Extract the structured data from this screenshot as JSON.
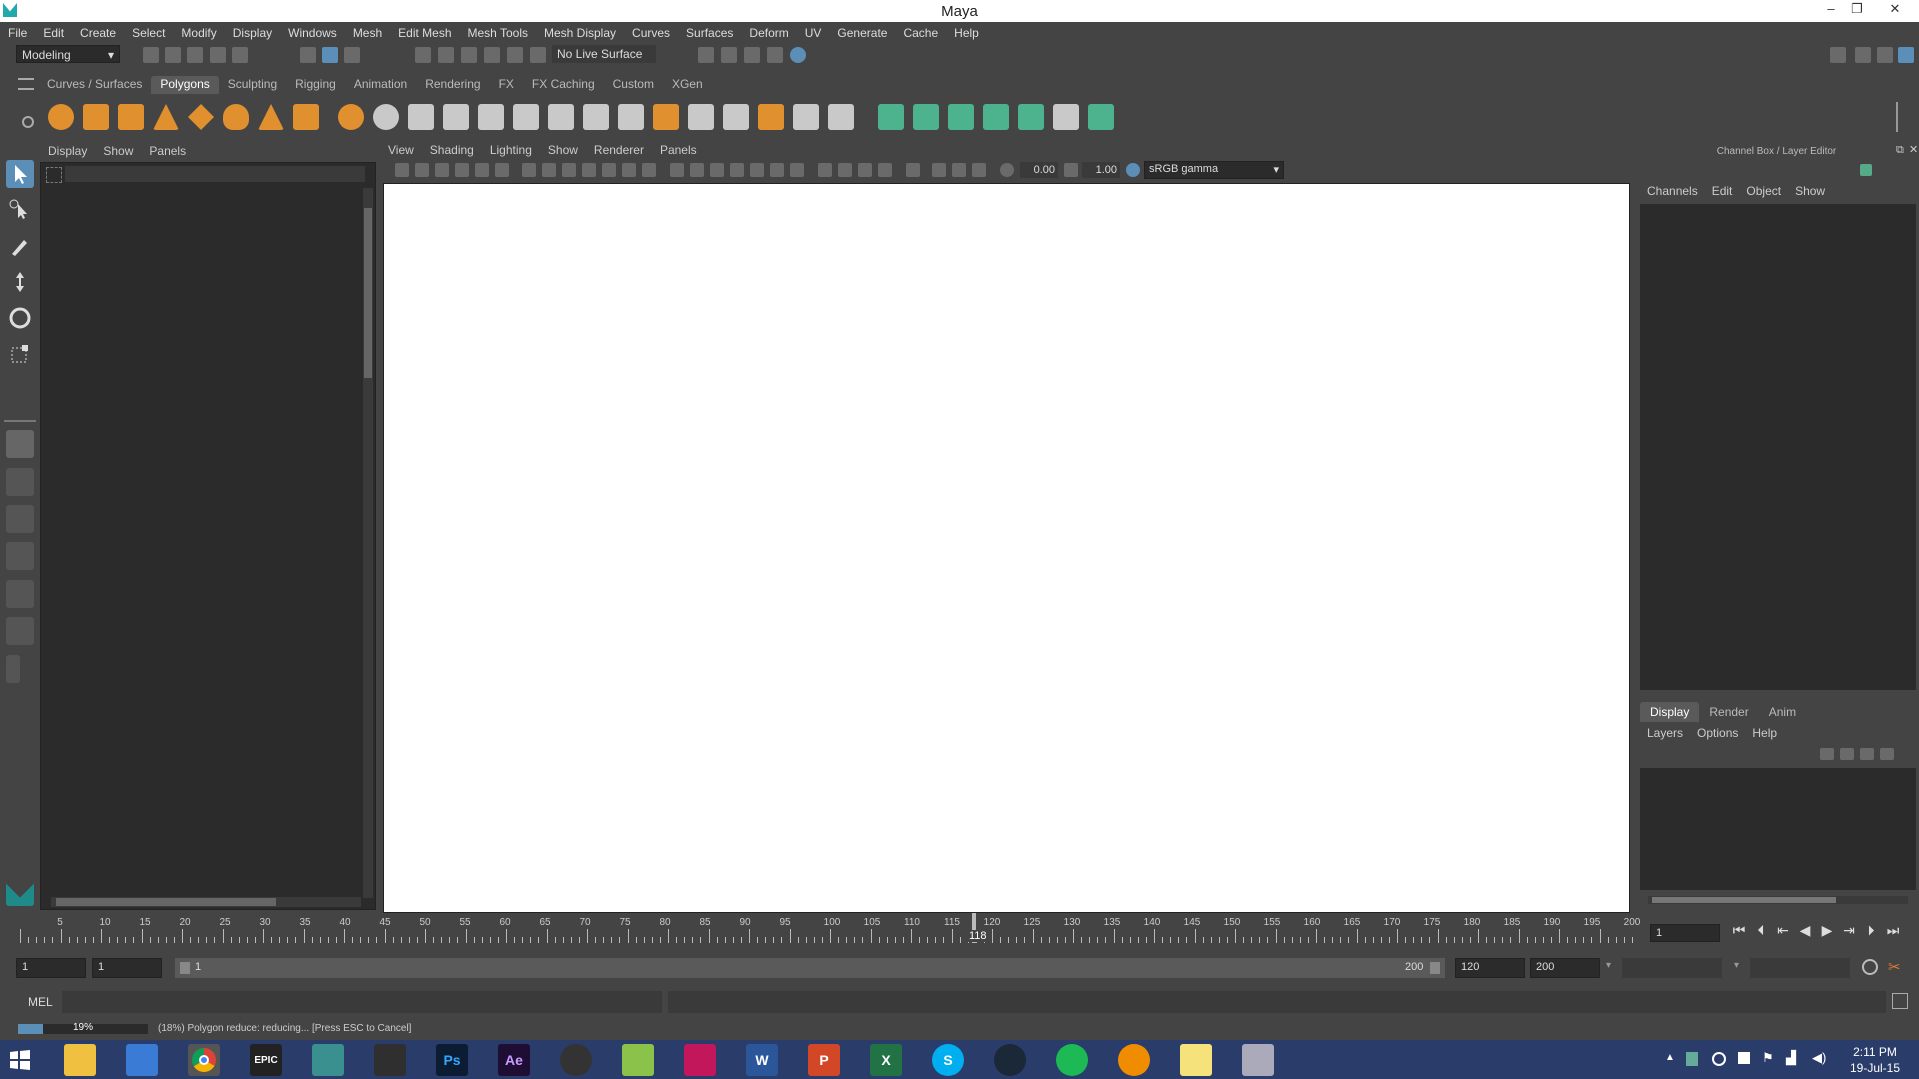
{
  "window": {
    "title": "Maya",
    "minimize": "–",
    "restore": "❐",
    "close": "✕"
  },
  "menubar": [
    "File",
    "Edit",
    "Create",
    "Select",
    "Modify",
    "Display",
    "Windows",
    "Mesh",
    "Edit Mesh",
    "Mesh Tools",
    "Mesh Display",
    "Curves",
    "Surfaces",
    "Deform",
    "UV",
    "Generate",
    "Cache",
    "Help"
  ],
  "statusline": {
    "mode": "Modeling",
    "live_surface": "No Live Surface"
  },
  "shelf": {
    "tabs": [
      "Curves / Surfaces",
      "Polygons",
      "Sculpting",
      "Rigging",
      "Animation",
      "Rendering",
      "FX",
      "FX Caching",
      "Custom",
      "XGen"
    ],
    "active": "Polygons"
  },
  "outliner": {
    "menu": [
      "Display",
      "Show",
      "Panels"
    ]
  },
  "viewport": {
    "menu": [
      "View",
      "Shading",
      "Lighting",
      "Show",
      "Renderer",
      "Panels"
    ],
    "exposure": "0.00",
    "gamma": "1.00",
    "color_space": "sRGB gamma"
  },
  "channel_box": {
    "title": "Channel Box / Layer Editor",
    "menu": [
      "Channels",
      "Edit",
      "Object",
      "Show"
    ],
    "layer_tabs": [
      "Display",
      "Render",
      "Anim"
    ],
    "layer_tab_active": "Display",
    "layer_menu": [
      "Layers",
      "Options",
      "Help"
    ]
  },
  "timeline": {
    "ticks": [
      "5",
      "10",
      "15",
      "20",
      "25",
      "30",
      "35",
      "40",
      "45",
      "50",
      "55",
      "60",
      "65",
      "70",
      "75",
      "80",
      "85",
      "90",
      "95",
      "100",
      "105",
      "110",
      "115",
      "120",
      "125",
      "130",
      "135",
      "140",
      "145",
      "150",
      "155",
      "160",
      "165",
      "170",
      "175",
      "180",
      "185",
      "190",
      "195",
      "200"
    ],
    "current": "118",
    "current_frame_field": "1"
  },
  "range": {
    "start": "1",
    "playback_start": "1",
    "range_start_label": "1",
    "range_end_label": "200",
    "playback_end": "120",
    "end": "200"
  },
  "command": {
    "label": "MEL"
  },
  "help": {
    "progress_percent": "19%",
    "progress": 0.19,
    "message": "(18%) Polygon reduce: reducing... [Press ESC to Cancel]"
  },
  "taskbar": {
    "time": "2:11 PM",
    "date": "19-Jul-15",
    "apps": [
      "File Explorer",
      "Control Panel",
      "Google Chrome",
      "Epic Games",
      "Maya",
      "Task app",
      "Photoshop",
      "After Effects",
      "DaVinci",
      "Notepad",
      "Camera",
      "Word",
      "PowerPoint",
      "Excel",
      "Skype",
      "Steam",
      "Spotify",
      "Gadget",
      "Sticky Notes",
      "Maya window"
    ]
  }
}
